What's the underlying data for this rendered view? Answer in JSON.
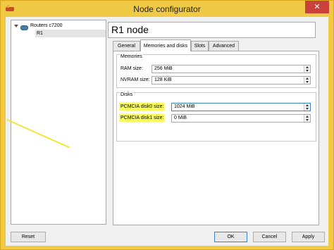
{
  "window": {
    "title": "Node configurator",
    "close_glyph": "✕"
  },
  "tree": {
    "group_label": "Routers c7200",
    "child_label": "R1"
  },
  "node": {
    "title": "R1 node"
  },
  "tabs": [
    {
      "label": "General",
      "active": false
    },
    {
      "label": "Memories and disks",
      "active": true
    },
    {
      "label": "Slots",
      "active": false
    },
    {
      "label": "Advanced",
      "active": false
    }
  ],
  "memories": {
    "title": "Memories",
    "ram_label": "RAM size:",
    "ram_value": "256 MiB",
    "nvram_label": "NVRAM size:",
    "nvram_value": "128 KiB"
  },
  "disks": {
    "title": "Disks",
    "disk0_label": "PCMCIA disk0 size:",
    "disk0_value": "1024 MiB",
    "disk1_label": "PCMCIA disk1 size:",
    "disk1_value": "0 MiB"
  },
  "buttons": {
    "reset": "Reset",
    "ok": "OK",
    "cancel": "Cancel",
    "apply": "Apply"
  },
  "highlight_color": "#fbfb5c"
}
